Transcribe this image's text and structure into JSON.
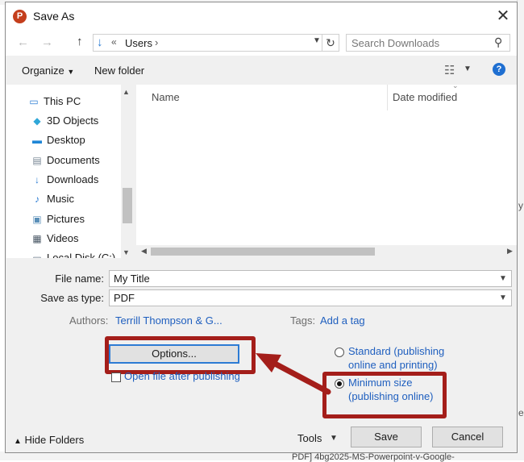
{
  "window": {
    "title": "Save As",
    "app_icon": "powerpoint-icon",
    "close_glyph": "✕"
  },
  "navigation": {
    "back_glyph": "←",
    "forward_glyph": "→",
    "up_glyph": "↑",
    "breadcrumb_separator": "«",
    "path": "Users",
    "path_chevron": "›",
    "refresh_glyph": "↻",
    "search_placeholder": "Search Downloads"
  },
  "toolbar": {
    "organize_label": "Organize",
    "new_folder_label": "New folder"
  },
  "sidebar": {
    "items": [
      {
        "label": "This PC",
        "icon": "this-pc-icon"
      },
      {
        "label": "3D Objects",
        "icon": "cube-icon"
      },
      {
        "label": "Desktop",
        "icon": "desktop-icon"
      },
      {
        "label": "Documents",
        "icon": "document-icon"
      },
      {
        "label": "Downloads",
        "icon": "download-icon"
      },
      {
        "label": "Music",
        "icon": "music-icon"
      },
      {
        "label": "Pictures",
        "icon": "picture-icon"
      },
      {
        "label": "Videos",
        "icon": "video-icon"
      },
      {
        "label": "Local Disk (C:)",
        "icon": "drive-icon"
      }
    ]
  },
  "file_list": {
    "columns": [
      "Name",
      "Date modified"
    ]
  },
  "form": {
    "file_name_label": "File name:",
    "file_name_value": "My Title",
    "save_type_label": "Save as type:",
    "save_type_value": "PDF",
    "authors_label": "Authors:",
    "authors_value": "Terrill Thompson & G...",
    "tags_label": "Tags:",
    "tags_value": "Add a tag"
  },
  "options": {
    "options_button": "Options...",
    "open_after_publishing": "Open file after publishing",
    "optimize": {
      "standard_line1": "Standard (publishing",
      "standard_line2": "online and printing)",
      "minimum_line1": "Minimum size",
      "minimum_line2": "(publishing online)",
      "selected": "minimum"
    }
  },
  "footer": {
    "hide_folders_label": "Hide Folders",
    "tools_label": "Tools",
    "save_label": "Save",
    "cancel_label": "Cancel"
  },
  "background": {
    "right_fragments": [
      "y",
      "e-"
    ],
    "bottom_fragment": "PDF]    4bg2025-MS-Powerpoint-v-Google-"
  },
  "colors": {
    "annotation_red": "#a41e1a",
    "link_blue": "#1f5fbf",
    "focus_blue": "#2d7bd4"
  }
}
